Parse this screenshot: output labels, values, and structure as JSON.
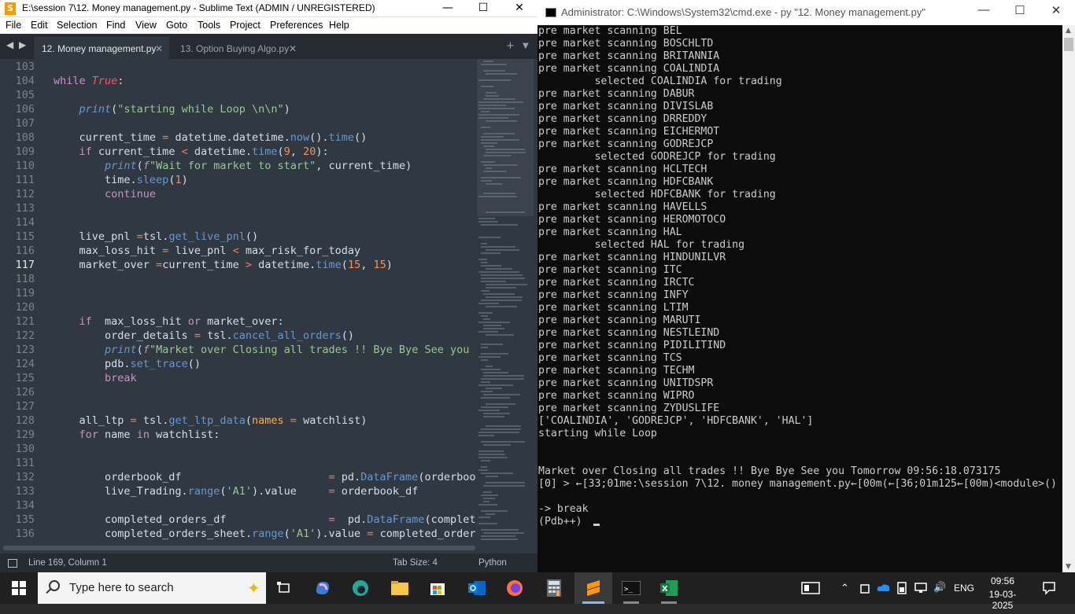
{
  "sublime": {
    "title": "E:\\session 7\\12. Money management.py - Sublime Text (ADMIN / UNREGISTERED)",
    "menu": [
      "File",
      "Edit",
      "Selection",
      "Find",
      "View",
      "Goto",
      "Tools",
      "Project",
      "Preferences",
      "Help"
    ],
    "tabs": [
      {
        "label": "12. Money management.py",
        "active": true
      },
      {
        "label": "13. Option Buying Algo.py",
        "active": false
      }
    ],
    "line_numbers": [
      "103",
      "104",
      "105",
      "106",
      "107",
      "108",
      "109",
      "110",
      "111",
      "112",
      "113",
      "114",
      "115",
      "116",
      "117",
      "118",
      "119",
      "120",
      "121",
      "122",
      "123",
      "124",
      "125",
      "126",
      "127",
      "128",
      "129",
      "130",
      "131",
      "132",
      "133",
      "134",
      "135",
      "136"
    ],
    "current_line": "117",
    "status": {
      "position": "Line 169, Column 1",
      "tab_size": "Tab Size: 4",
      "syntax": "Python"
    }
  },
  "cmd": {
    "title": "Administrator: C:\\Windows\\System32\\cmd.exe - py  \"12. Money management.py\"",
    "lines": [
      "pre market scanning BEL",
      "pre market scanning BOSCHLTD",
      "pre market scanning BRITANNIA",
      "pre market scanning COALINDIA",
      "         selected COALINDIA for trading",
      "pre market scanning DABUR",
      "pre market scanning DIVISLAB",
      "pre market scanning DRREDDY",
      "pre market scanning EICHERMOT",
      "pre market scanning GODREJCP",
      "         selected GODREJCP for trading",
      "pre market scanning HCLTECH",
      "pre market scanning HDFCBANK",
      "         selected HDFCBANK for trading",
      "pre market scanning HAVELLS",
      "pre market scanning HEROMOTOCO",
      "pre market scanning HAL",
      "         selected HAL for trading",
      "pre market scanning HINDUNILVR",
      "pre market scanning ITC",
      "pre market scanning IRCTC",
      "pre market scanning INFY",
      "pre market scanning LTIM",
      "pre market scanning MARUTI",
      "pre market scanning NESTLEIND",
      "pre market scanning PIDILITIND",
      "pre market scanning TCS",
      "pre market scanning TECHM",
      "pre market scanning UNITDSPR",
      "pre market scanning WIPRO",
      "pre market scanning ZYDUSLIFE",
      "['COALINDIA', 'GODREJCP', 'HDFCBANK', 'HAL']",
      "starting while Loop",
      "",
      "",
      "Market over Closing all trades !! Bye Bye See you Tomorrow 09:56:18.073175",
      "[0] > ←[33;01me:\\session 7\\12. money management.py←[00m(←[36;01m125←[00m)<module>()",
      "",
      "-> break",
      "(Pdb++) "
    ]
  },
  "taskbar": {
    "search_placeholder": "Type here to search",
    "time": "09:56",
    "date": "19-03-2025",
    "lang": "ENG"
  }
}
